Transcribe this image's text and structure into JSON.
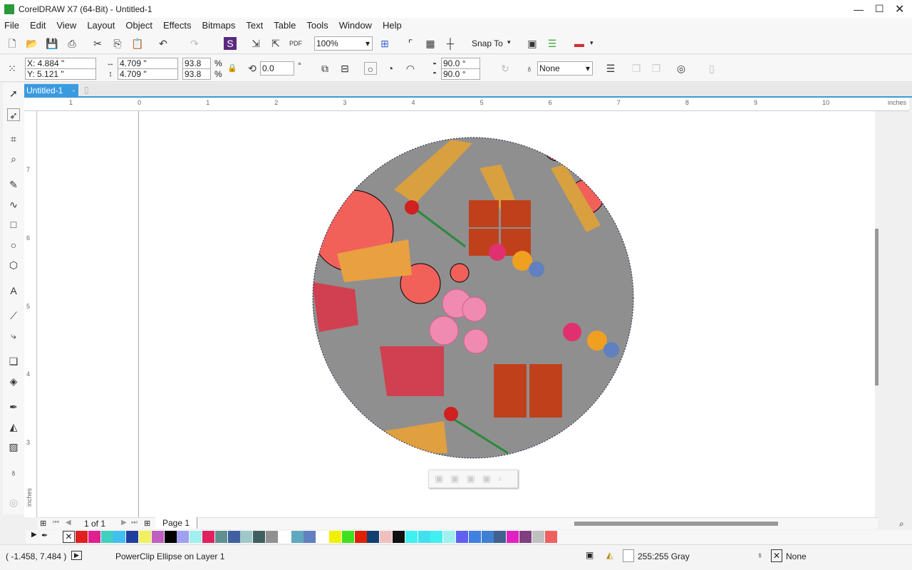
{
  "title": "CorelDRAW X7 (64-Bit) - Untitled-1",
  "menu": [
    "File",
    "Edit",
    "View",
    "Layout",
    "Object",
    "Effects",
    "Bitmaps",
    "Text",
    "Table",
    "Tools",
    "Window",
    "Help"
  ],
  "toolbar": {
    "zoom": "100%",
    "snap_to": "Snap To"
  },
  "properties": {
    "x": "X: 4.884 \"",
    "y": "Y: 5.121 \"",
    "width": "4.709 \"",
    "height": "4.709 \"",
    "scale_w": "93.8",
    "scale_h": "93.8",
    "pct": "%",
    "rotation": "0.0",
    "deg": "°",
    "start_angle": "90.0 °",
    "end_angle": "90.0 °",
    "outline": "None"
  },
  "doc_tab": "Untitled-1",
  "ruler": {
    "h_labels": [
      "1",
      "0",
      "1",
      "2",
      "3",
      "4",
      "5",
      "6",
      "7",
      "8",
      "9",
      "10"
    ],
    "h_unit": "inches",
    "v_labels": [
      "7",
      "6",
      "5",
      "4",
      "3"
    ],
    "v_unit": "inches"
  },
  "page_nav": {
    "count": "1 of 1",
    "page_tab": "Page 1"
  },
  "palette": [
    "#e02020",
    "#e02090",
    "#40d0c0",
    "#40c0f0",
    "#2040a0",
    "#f0f060",
    "#c060c0",
    "#000000",
    "#a0a0f0",
    "#a0f0f0",
    "#e02060",
    "#609090",
    "#4060a0",
    "#a0c8c8",
    "#406060",
    "#909090",
    "#ffffff",
    "#60a8c0",
    "#6080c0",
    "#ffffff",
    "#f0f000",
    "#40e020",
    "#e02000",
    "#104070",
    "#f0c0c0",
    "#101010",
    "#40f0f0",
    "#40e0f0",
    "#40f0f0",
    "#a0f0f0",
    "#6060f0",
    "#4080e0",
    "#4080d0",
    "#406090",
    "#e020c0",
    "#804080",
    "#c0c0c0",
    "#f06060"
  ],
  "status": {
    "coords": "( -1.458, 7.484 )",
    "object": "PowerClip Ellipse on Layer 1",
    "fill": "255:255 Gray",
    "outline": "None"
  }
}
